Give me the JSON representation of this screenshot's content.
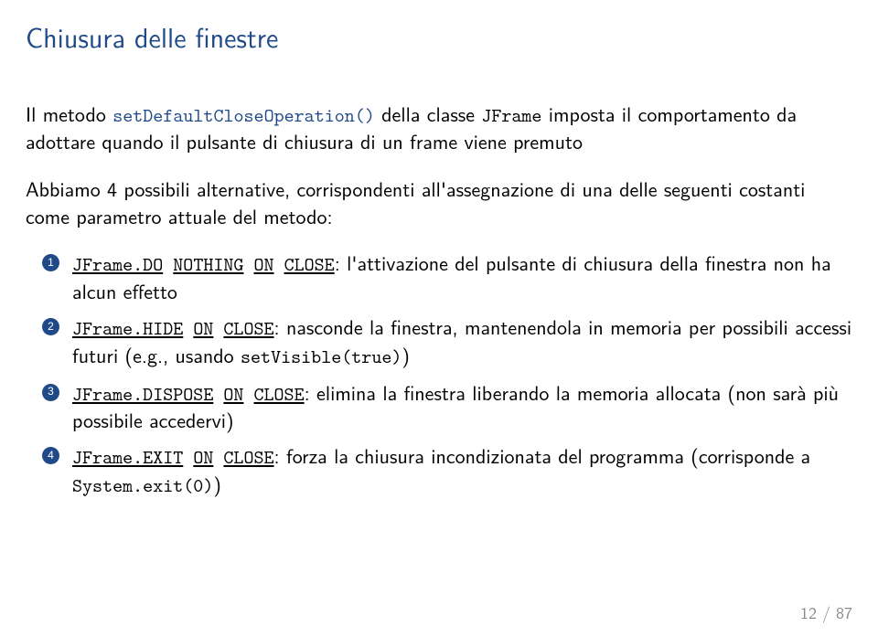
{
  "title": "Chiusura delle finestre",
  "para1_a": "Il metodo ",
  "para1_code": "setDefaultCloseOperation()",
  "para1_b": " della classe ",
  "para1_code2": "JFrame",
  "para1_c": " imposta il comportamento da adottare quando il pulsante di chiusura di un frame viene premuto",
  "para2": "Abbiamo 4 possibili alternative, corrispondenti all'assegnazione di una delle seguenti costanti come parametro attuale del metodo:",
  "items": [
    {
      "num": "1",
      "code_a": "JFrame.DO",
      "code_b": "NOTHING",
      "code_c": "ON",
      "code_d": "CLOSE",
      "text": ": l'attivazione del pulsante di chiusura della finestra non ha alcun effetto",
      "tail_code": "",
      "tail_text": ""
    },
    {
      "num": "2",
      "code_a": "JFrame.HIDE",
      "code_b": "ON",
      "code_c": "CLOSE",
      "code_d": "",
      "text": ": nasconde la finestra, mantenendola in memoria per possibili accessi futuri (e.g., usando ",
      "tail_code": "setVisible(true)",
      "tail_text": ")"
    },
    {
      "num": "3",
      "code_a": "JFrame.DISPOSE",
      "code_b": "ON",
      "code_c": "CLOSE",
      "code_d": "",
      "text": ": elimina la finestra liberando la memoria allocata (non sarà più possibile accedervi)",
      "tail_code": "",
      "tail_text": ""
    },
    {
      "num": "4",
      "code_a": "JFrame.EXIT",
      "code_b": "ON",
      "code_c": "CLOSE",
      "code_d": "",
      "text": ": forza la chiusura incondizionata del programma (corrisponde a ",
      "tail_code": "System.exit(0)",
      "tail_text": ")"
    }
  ],
  "footer": "12 / 87"
}
